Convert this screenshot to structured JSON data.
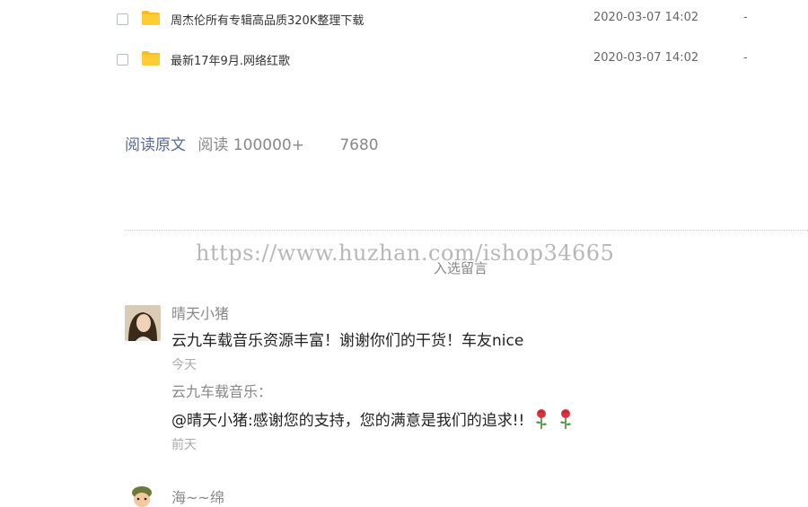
{
  "files": [
    {
      "name": "周杰伦所有专辑高品质320K整理下载",
      "date": "2020-03-07 14:02",
      "size": "-",
      "icon": "folder-icon"
    },
    {
      "name": "最新17年9月.网络红歌",
      "date": "2020-03-07 14:02",
      "size": "-",
      "icon": "folder-icon"
    }
  ],
  "stats": {
    "read_original": "阅读原文",
    "read_count": "阅读 100000+",
    "like_count": "7680"
  },
  "watermark": "https://www.huzhan.com/ishop34665",
  "featured_title": "入选留言",
  "comments": [
    {
      "nickname": "晴天小猪",
      "text": "云九车载音乐资源丰富！谢谢你们的干货！车友nice",
      "time": "今天",
      "reply_label": "云九车载音乐：",
      "reply_text": "@晴天小猪:感谢您的支持，您的满意是我们的追求!!",
      "reply_time": "前天"
    },
    {
      "nickname": "海~~绵"
    }
  ],
  "colors": {
    "folder": "#f5bf1e",
    "link": "#576b95",
    "rose": "#d9333f"
  }
}
